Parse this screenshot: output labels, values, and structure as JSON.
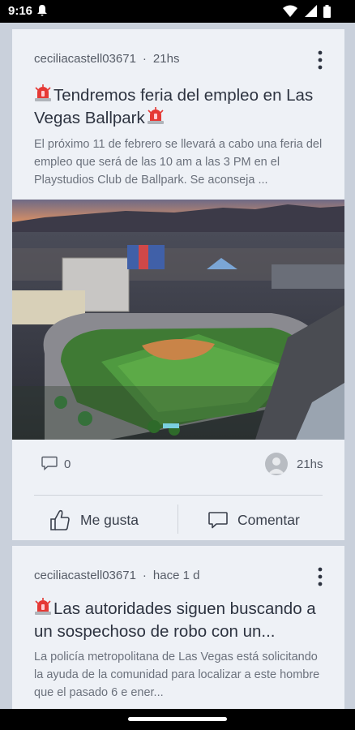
{
  "status": {
    "time": "9:16",
    "icons": [
      "notification-bell-icon",
      "wifi-icon",
      "signal-icon",
      "battery-icon"
    ]
  },
  "posts": [
    {
      "author": "ceciliacastell03671",
      "separator": "·",
      "time": "21hs",
      "title": "Tendremos feria del empleo en Las Vegas Ballpark",
      "excerpt": "El próximo 11 de febrero se llevará a cabo una feria del empleo que será de las 10 am a las 3 PM en el Playstudios Club de Ballpark. Se aconseja ...",
      "comments": "0",
      "last_activity": "21hs",
      "like_label": "Me gusta",
      "comment_label": "Comentar"
    },
    {
      "author": "ceciliacastell03671",
      "separator": "·",
      "time": "hace 1 d",
      "title": "Las autoridades siguen buscando a un sospechoso de robo con un...",
      "excerpt": "La policía metropolitana de Las Vegas está solicitando la ayuda de la comunidad para localizar a este hombre que el pasado 6 e ener..."
    }
  ],
  "colors": {
    "card_bg": "#eef1f6",
    "screen_bg": "#c9d0db",
    "siren_red": "#e53935"
  }
}
